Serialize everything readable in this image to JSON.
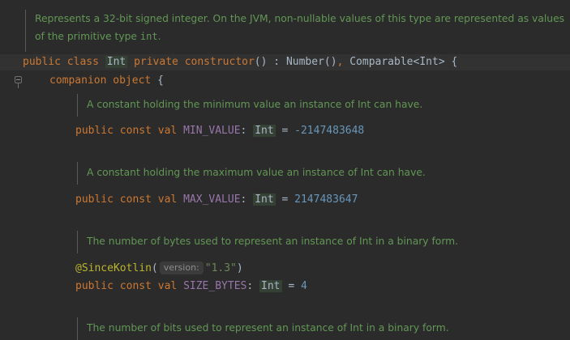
{
  "doc_class": {
    "line1": "Represents a 32-bit signed integer. On the JVM, non-nullable values of this type are represented as values",
    "line2_prefix": "of the primitive type ",
    "line2_code": "int",
    "line2_suffix": "."
  },
  "class_decl": {
    "kw_public": "public",
    "kw_class": "class",
    "name": "Int",
    "kw_private": "private",
    "kw_constructor": "constructor",
    "parens": "()",
    "colon": " : ",
    "super1": "Number()",
    "comma": ",",
    "super2": "Comparable",
    "lt": "<",
    "type_arg": "Int",
    "gt": ">",
    "brace": " {"
  },
  "companion": {
    "kw_companion": "companion",
    "kw_object": "object",
    "brace": " {"
  },
  "members": [
    {
      "doc": "A constant holding the minimum value an instance of Int can have.",
      "kw_public": "public",
      "kw_const": "const",
      "kw_val": "val",
      "name": "MIN_VALUE",
      "colon": ": ",
      "type": "Int",
      "eq": " = ",
      "value": "-2147483648"
    },
    {
      "doc": "A constant holding the maximum value an instance of Int can have.",
      "kw_public": "public",
      "kw_const": "const",
      "kw_val": "val",
      "name": "MAX_VALUE",
      "colon": ": ",
      "type": "Int",
      "eq": " = ",
      "value": "2147483647"
    },
    {
      "doc": "The number of bytes used to represent an instance of Int in a binary form.",
      "annotation": "@SinceKotlin",
      "open_paren": "(",
      "hint": "version:",
      "arg": "\"1.3\"",
      "close_paren": ")",
      "kw_public": "public",
      "kw_const": "const",
      "kw_val": "val",
      "name": "SIZE_BYTES",
      "colon": ": ",
      "type": "Int",
      "eq": " = ",
      "value": "4"
    },
    {
      "doc": "The number of bits used to represent an instance of Int in a binary form."
    }
  ]
}
